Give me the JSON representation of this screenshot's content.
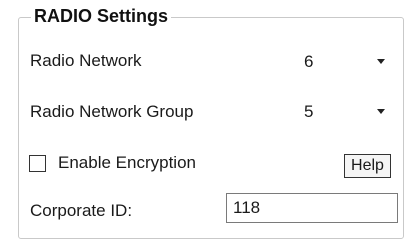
{
  "group": {
    "title": "RADIO Settings"
  },
  "radio_network": {
    "label": "Radio Network",
    "value": "6"
  },
  "radio_network_group": {
    "label": "Radio Network Group",
    "value": "5"
  },
  "encryption": {
    "label": "Enable Encryption",
    "checked": false
  },
  "help": {
    "label": "Help"
  },
  "corporate_id": {
    "label": "Corporate ID:",
    "value": "118"
  }
}
